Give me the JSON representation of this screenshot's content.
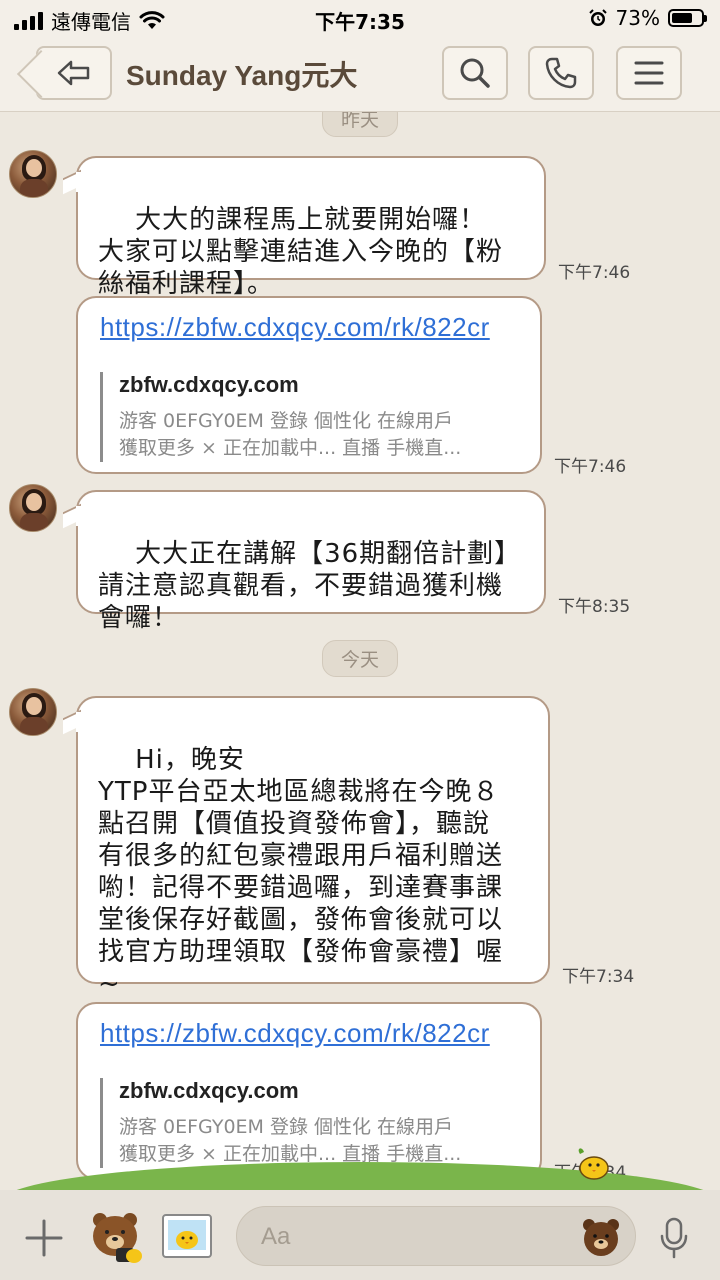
{
  "status_bar": {
    "carrier": "遠傳電信",
    "time": "下午7:35",
    "battery_percent": "73%",
    "battery_level": 0.73
  },
  "header": {
    "title": "Sunday Yang元大",
    "icons": [
      "back-icon",
      "search-icon",
      "phone-icon",
      "menu-icon"
    ]
  },
  "chat": {
    "date_yesterday": "昨天",
    "date_today": "今天",
    "messages": [
      {
        "type": "text",
        "text": "大大的課程馬上就要開始囉！\n大家可以點擊連結進入今晚的【粉\n絲福利課程】。",
        "time": "下午7:46"
      },
      {
        "type": "link",
        "url": "https://zbfw.cdxqcy.com/rk/822cr",
        "domain": "zbfw.cdxqcy.com",
        "description": "游客 0EFGY0EM 登錄 個性化 在線用戶\n獲取更多 × 正在加載中... 直播 手機直...",
        "time": "下午7:46"
      },
      {
        "type": "text",
        "text": "大大正在講解【36期翻倍計劃】\n請注意認真觀看，不要錯過獲利機\n會囉！",
        "time": "下午8:35"
      },
      {
        "type": "text",
        "text": "Hi，晚安\nYTP平台亞太地區總裁將在今晚８\n點召開【價值投資發佈會】，聽說\n有很多的紅包豪禮跟用戶福利贈送\n喲！記得不要錯過囉，到達賽事課\n堂後保存好截圖，發佈會後就可以\n找官方助理領取【發佈會豪禮】喔\n~",
        "time": "下午7:34"
      },
      {
        "type": "link",
        "url": "https://zbfw.cdxqcy.com/rk/822cr",
        "domain": "zbfw.cdxqcy.com",
        "description": "游客 0EFGY0EM 登錄 個性化 在線用戶\n獲取更多 × 正在加載中... 直播 手機直...",
        "time": "下午7:34"
      }
    ]
  },
  "input_bar": {
    "placeholder": "Aa",
    "value": ""
  },
  "colors": {
    "background": "#ede8df",
    "bubble_border": "#b49a86",
    "link": "#2f6fd6",
    "grass": "#7ab54b"
  }
}
